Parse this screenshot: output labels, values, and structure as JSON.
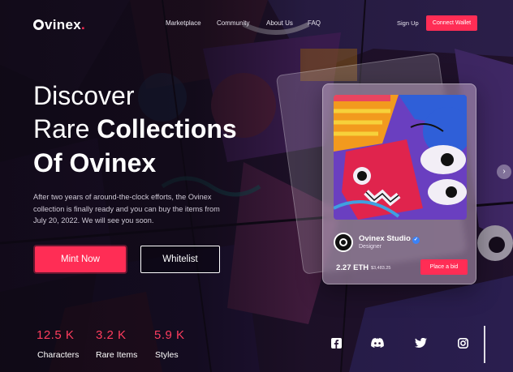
{
  "brand": {
    "name": "Ovinex",
    "accent": "#ff2d55"
  },
  "nav": {
    "links": [
      "Marketplace",
      "Community",
      "About Us",
      "FAQ"
    ],
    "signup": "Sign Up",
    "connect": "Connect Wallet"
  },
  "hero": {
    "line1": "Discover",
    "line2_light": "Rare ",
    "line2_bold": "Collections",
    "line3": "Of Ovinex",
    "description": "After two years of around-the-clock efforts, the Ovinex collection is finally ready and you can buy the items from July 20, 2022. We will see you soon.",
    "mint_button": "Mint Now",
    "whitelist_button": "Whitelist"
  },
  "stats": [
    {
      "value": "12.5 K",
      "label": "Characters"
    },
    {
      "value": "3.2 K",
      "label": "Rare Items"
    },
    {
      "value": "5.9 K",
      "label": "Styles"
    }
  ],
  "card": {
    "creator": "Ovinex Studio",
    "role": "Designer",
    "price": "2.27 ETH",
    "price_usd": "$3,483.25",
    "bid_button": "Place a bid"
  },
  "socials": [
    "facebook-icon",
    "discord-icon",
    "twitter-icon",
    "instagram-icon"
  ]
}
